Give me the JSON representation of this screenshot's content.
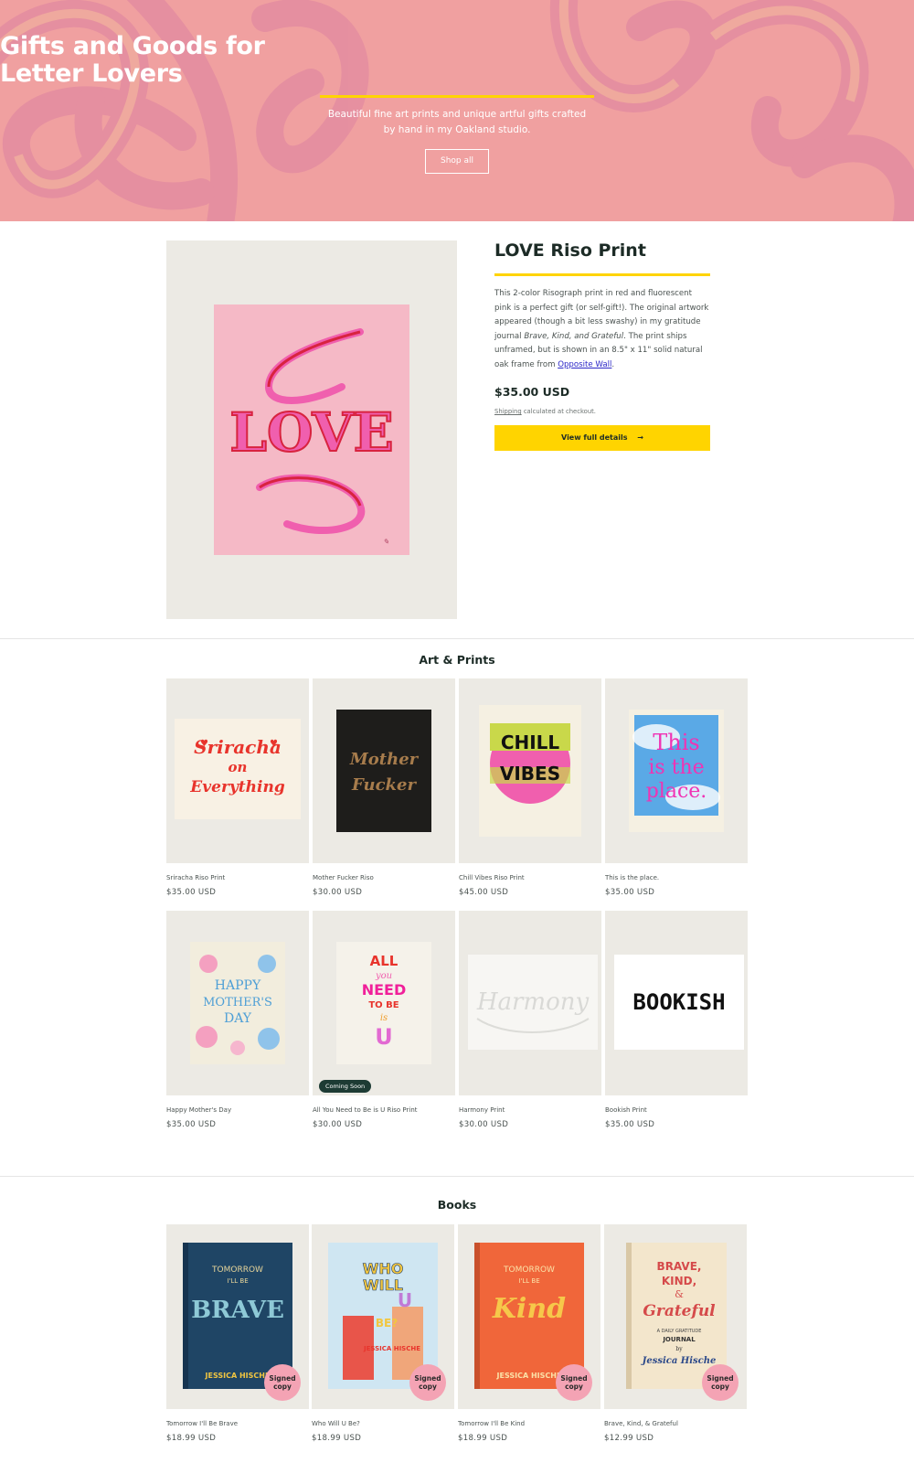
{
  "hero": {
    "title_line1": "Gifts and Goods for",
    "title_line2": "Letter Lovers",
    "subtitle_line1": "Beautiful fine art prints and unique artful gifts crafted",
    "subtitle_line2": "by hand in my Oakland studio.",
    "button_label": "Shop all"
  },
  "featured": {
    "title": "LOVE Riso Print",
    "desc_part1": "This 2-color Risograph print in red and fluorescent pink is a perfect gift (or self-gift!). The original artwork appeared (though a bit less swashy) in my gratitude journal ",
    "desc_italic": "Brave, Kind, and Grateful",
    "desc_part2": ". The print ships unframed, but is shown in an 8.5\" x 11\" solid natural oak frame from ",
    "desc_link": "Opposite Wall",
    "desc_end": ".",
    "price": "$35.00 USD",
    "shipping_link": "Shipping",
    "shipping_text": " calculated at checkout.",
    "button_label": "View full details",
    "button_arrow": "→",
    "art_text": "LOVE"
  },
  "art_prints": {
    "heading": "Art & Prints",
    "items": [
      {
        "name": "Sriracha Riso Print",
        "price": "$35.00 USD",
        "art": [
          "Sriracha",
          "on",
          "Everything"
        ]
      },
      {
        "name": "Mother Fucker Riso",
        "price": "$30.00 USD",
        "art": [
          "Mother",
          "Fucker"
        ]
      },
      {
        "name": "Chill Vibes Riso Print",
        "price": "$45.00 USD",
        "art": [
          "CHILL",
          "VIBES"
        ]
      },
      {
        "name": "This is the place.",
        "price": "$35.00 USD",
        "art": [
          "This",
          "is the",
          "place."
        ]
      },
      {
        "name": "Happy Mother's Day",
        "price": "$35.00 USD",
        "art": [
          "HAPPY",
          "MOTHER'S",
          "DAY"
        ]
      },
      {
        "name": "All You Need to Be is U Riso Print",
        "price": "$30.00 USD",
        "badge": "Coming Soon",
        "art": [
          "ALL",
          "you",
          "NEED",
          "TO BE",
          "is",
          "U"
        ]
      },
      {
        "name": "Harmony Print",
        "price": "$30.00 USD",
        "art": [
          "Harmony"
        ]
      },
      {
        "name": "Bookish Print",
        "price": "$35.00 USD",
        "art": [
          "BOOKISH"
        ]
      }
    ]
  },
  "books": {
    "heading": "Books",
    "signed_label_1": "Signed",
    "signed_label_2": "copy",
    "items": [
      {
        "name": "Tomorrow I'll Be Brave",
        "price": "$18.99 USD",
        "art": [
          "TOMORROW",
          "I'LL BE",
          "BRAVE",
          "JESSICA HISCHE"
        ]
      },
      {
        "name": "Who Will U Be?",
        "price": "$18.99 USD",
        "art": [
          "WHO",
          "WILL",
          "U",
          "BE?",
          "JESSICA HISCHE"
        ]
      },
      {
        "name": "Tomorrow I'll Be Kind",
        "price": "$18.99 USD",
        "art": [
          "TOMORROW",
          "I'LL BE",
          "Kind",
          "JESSICA HISCHE"
        ]
      },
      {
        "name": "Brave, Kind, & Grateful",
        "price": "$12.99 USD",
        "art": [
          "BRAVE,",
          "KIND,",
          "&",
          "Grateful",
          "A DAILY GRATITUDE",
          "JOURNAL",
          "by",
          "Jessica Hische"
        ]
      }
    ]
  },
  "colors": {
    "hero_pink": "#f0a0a0",
    "accent_yellow": "#ffd400",
    "dark_green": "#1c2b26",
    "card_bg": "#eceae4"
  }
}
